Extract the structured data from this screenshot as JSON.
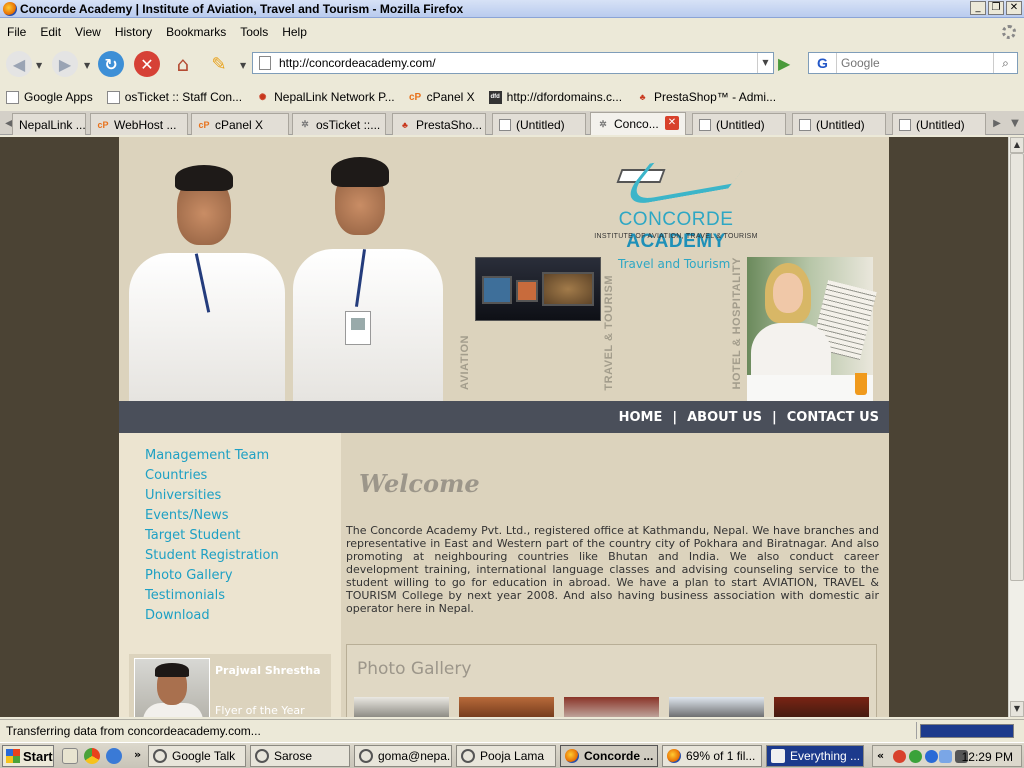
{
  "window": {
    "title": "Concorde Academy | Institute of Aviation, Travel and Tourism - Mozilla Firefox",
    "min_glyph": "_",
    "max_glyph": "❐",
    "close_glyph": "✕"
  },
  "menu": [
    "File",
    "Edit",
    "View",
    "History",
    "Bookmarks",
    "Tools",
    "Help"
  ],
  "navbar": {
    "url": "http://concordeacademy.com/",
    "search_placeholder": "Google",
    "search_engine_glyph": "G"
  },
  "bookmarks": [
    {
      "label": "Google Apps",
      "icon": "page-icon"
    },
    {
      "label": "osTicket :: Staff Con...",
      "icon": "page-icon"
    },
    {
      "label": "NepalLink Network P...",
      "icon": "nepallink-icon"
    },
    {
      "label": "cPanel X",
      "icon": "cpanel-icon"
    },
    {
      "label": "http://dfordomains.c...",
      "icon": "dfordomains-icon"
    },
    {
      "label": "PrestaShop™ - Admi...",
      "icon": "prestashop-icon"
    }
  ],
  "tabs": [
    {
      "label": "NepalLink ...",
      "icon": "nepallink-icon"
    },
    {
      "label": "WebHost ...",
      "icon": "cpanel-icon"
    },
    {
      "label": "cPanel X",
      "icon": "cpanel-icon"
    },
    {
      "label": "osTicket ::...",
      "icon": "gear-icon"
    },
    {
      "label": "PrestaSho...",
      "icon": "prestashop-icon"
    },
    {
      "label": "(Untitled)",
      "icon": "page-icon"
    },
    {
      "label": "Conco...",
      "icon": "gear-icon",
      "active": true
    },
    {
      "label": "(Untitled)",
      "icon": "page-icon"
    },
    {
      "label": "(Untitled)",
      "icon": "page-icon"
    },
    {
      "label": "(Untitled)",
      "icon": "page-icon"
    }
  ],
  "site": {
    "logo_name_a": "CONCORDE ",
    "logo_name_b": "ACADEMY",
    "logo_tagline": "INSTITUTE OF AVIATION, TRAVEL & TOURISM",
    "banner_labels": {
      "aviation": "AVIATION",
      "travel": "TRAVEL & TOURISM",
      "hotel": "HOTEL & HOSPITALITY",
      "travel_caption": "Travel and Tourism"
    },
    "topnav": [
      "HOME",
      "ABOUT US",
      "CONTACT US"
    ],
    "topnav_separator": "|",
    "sidenav": [
      "Management Team",
      "Countries",
      "Universities",
      "Events/News",
      "Target Student",
      "Student Registration",
      "Photo Gallery",
      "Testimonials",
      "Download"
    ],
    "featured": {
      "name": "Prajwal Shrestha",
      "title": "Flyer of the Year"
    },
    "welcome": "Welcome",
    "intro": "The Concorde Academy Pvt. Ltd., registered office at Kathmandu, Nepal. We have branches and representative in East and Western part of the country city of Pokhara and Biratnagar. And also promoting at neighbouring countries like Bhutan and India. We also conduct career development training, international language classes and advising counseling service to the student willing to go for education in abroad. We have a plan to start AVIATION, TRAVEL & TOURISM College by next year 2008. And also having business association with domestic air operator here in Nepal.",
    "gallery_title": "Photo Gallery"
  },
  "status": {
    "text": "Transferring data from concordeacademy.com...",
    "progress": 1.0
  },
  "taskbar": {
    "start": "Start",
    "tasks": [
      {
        "label": "Google Talk",
        "icon": "chat-icon"
      },
      {
        "label": "Sarose",
        "icon": "chat-icon"
      },
      {
        "label": "goma@nepa...",
        "icon": "chat-icon"
      },
      {
        "label": "Pooja Lama",
        "icon": "chat-icon"
      },
      {
        "label": "Concorde ...",
        "icon": "firefox-icon",
        "active": true
      },
      {
        "label": "69% of 1 fil...",
        "icon": "firefox-icon"
      },
      {
        "label": "Everything ...",
        "icon": "app-icon"
      }
    ],
    "clock": "12:29 PM"
  },
  "colors": {
    "accent": "#1ea0c4",
    "nav_strip": "#4a4f5a",
    "page_bg": "#4b4334"
  }
}
